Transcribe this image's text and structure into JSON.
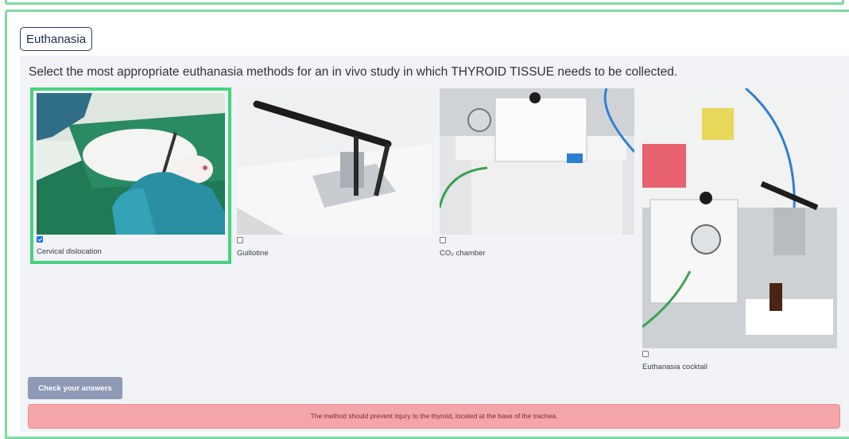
{
  "section": {
    "badge": "Euthanasia"
  },
  "question": "Select the most appropriate euthanasia methods for an in vivo study in which THYROID TISSUE needs to be collected.",
  "options": [
    {
      "label": "Cervical dislocation",
      "checked": true
    },
    {
      "label": "Guillotine",
      "checked": false
    },
    {
      "label": "CO₂ chamber",
      "checked": false
    },
    {
      "label": "Euthanasia cocktail",
      "checked": false
    }
  ],
  "check_button": "Check your answers",
  "feedback": "The method should prevent injury to the thyroid, located at the base of the trachea.",
  "colors": {
    "accent_green": "#46d37d",
    "button": "#8e9ab6",
    "alert_bg": "#f4a5a8"
  }
}
